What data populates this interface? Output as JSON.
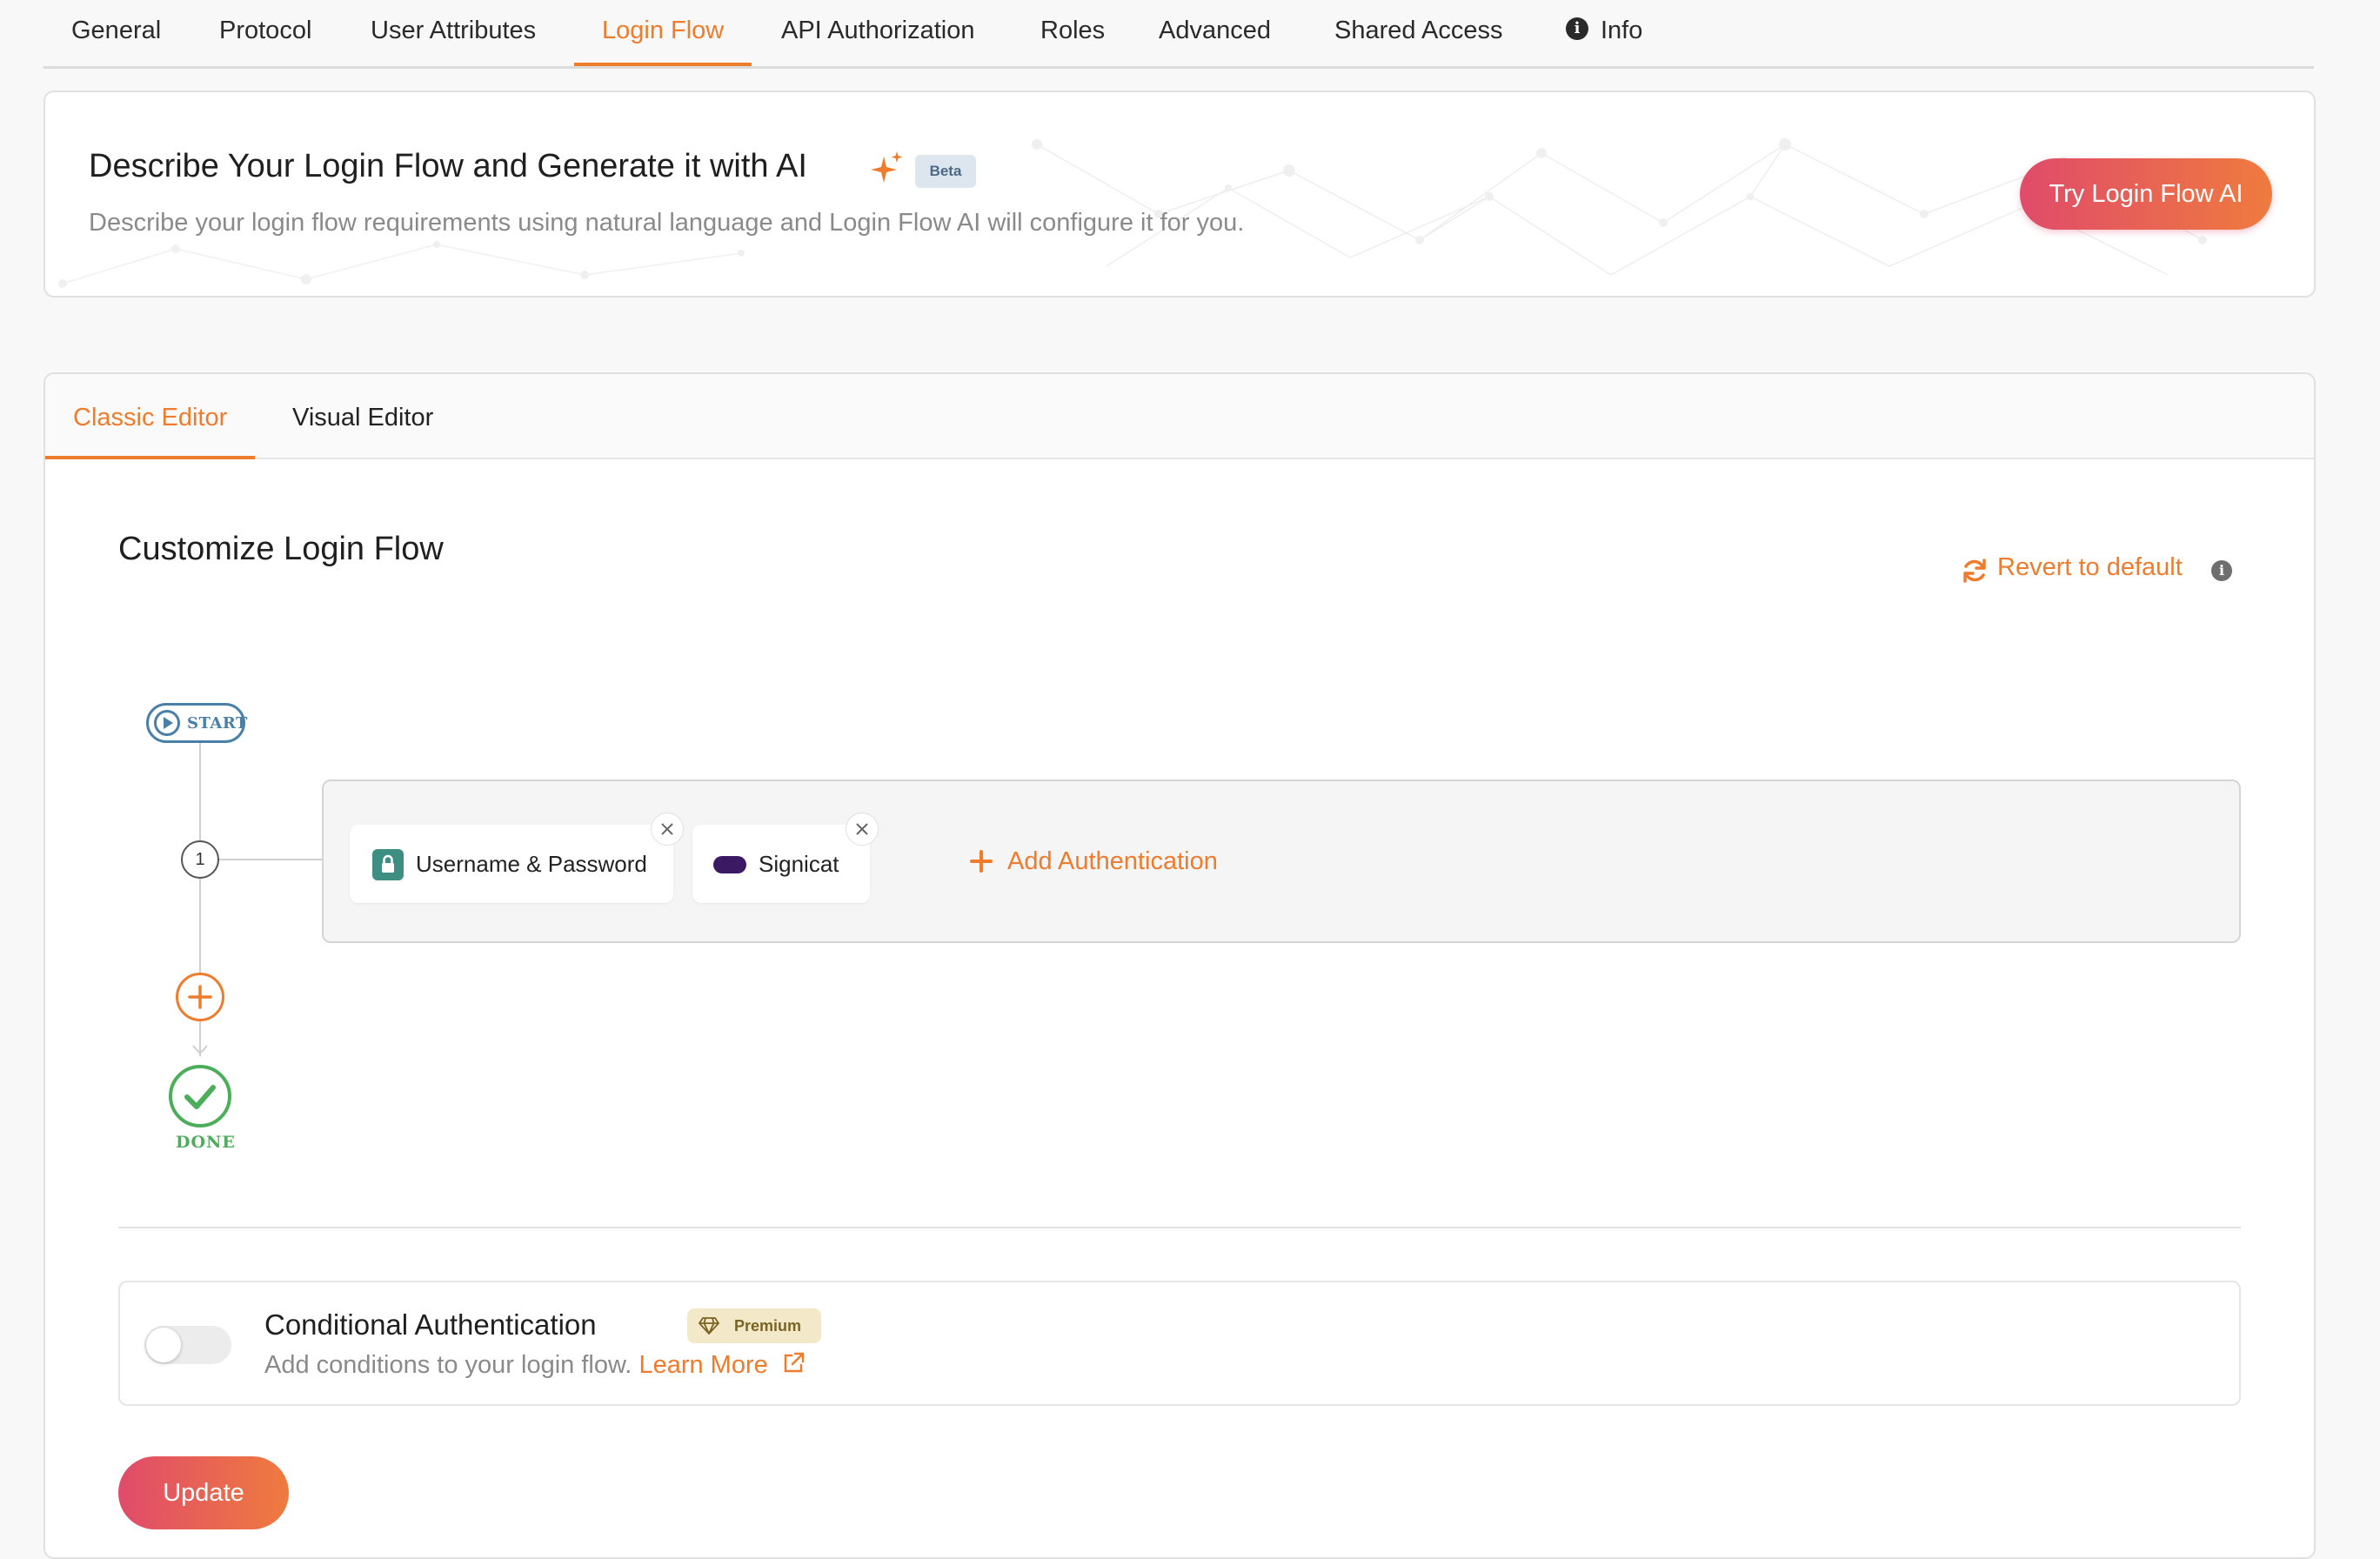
{
  "tabs": [
    {
      "label": "General"
    },
    {
      "label": "Protocol"
    },
    {
      "label": "User Attributes"
    },
    {
      "label": "Login Flow"
    },
    {
      "label": "API Authorization"
    },
    {
      "label": "Roles"
    },
    {
      "label": "Advanced"
    },
    {
      "label": "Shared Access"
    },
    {
      "label": "Info"
    }
  ],
  "active_tab": "Login Flow",
  "ai_banner": {
    "title": "Describe Your Login Flow and Generate it with AI",
    "badge": "Beta",
    "subtitle": "Describe your login flow requirements using natural language and Login Flow AI will configure it for you.",
    "button": "Try Login Flow AI"
  },
  "editor_tabs": [
    {
      "label": "Classic Editor"
    },
    {
      "label": "Visual Editor"
    }
  ],
  "active_editor_tab": "Classic Editor",
  "flow": {
    "title": "Customize Login Flow",
    "revert_label": "Revert to default",
    "start_label": "START",
    "step_number": "1",
    "auth_methods": [
      {
        "label": "Username & Password"
      },
      {
        "label": "Signicat"
      }
    ],
    "add_auth_label": "Add Authentication",
    "done_label": "DONE"
  },
  "conditional": {
    "title": "Conditional Authentication",
    "badge": "Premium",
    "description": "Add conditions to your login flow.",
    "learn_more": "Learn More"
  },
  "update_button": "Update",
  "colors": {
    "accent": "#ef7b2c",
    "success": "#4cae5a",
    "start": "#4a7fa8",
    "gradient_start": "#e04b6a",
    "gradient_end": "#ef7b3e"
  }
}
